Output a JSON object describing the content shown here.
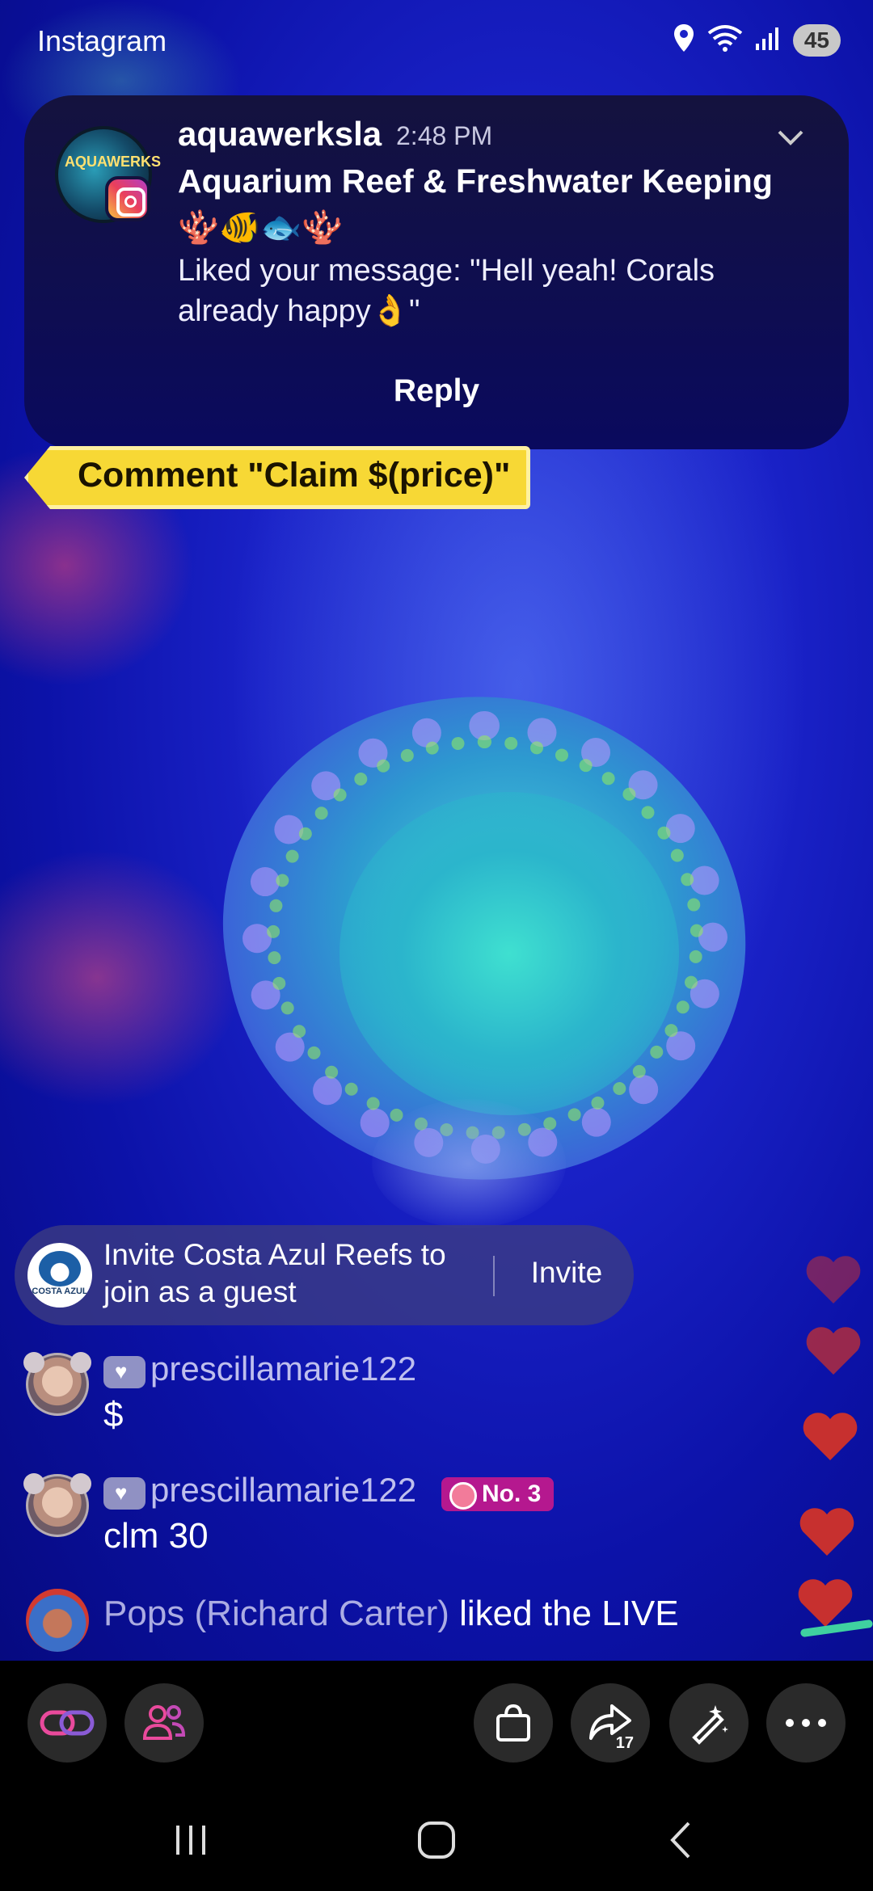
{
  "status": {
    "app_name": "Instagram",
    "battery": "45",
    "icons": [
      "location-icon",
      "wifi-icon",
      "signal-icon",
      "battery-icon"
    ]
  },
  "notification": {
    "username": "aquawerksla",
    "time": "2:48 PM",
    "title": "Aquarium Reef & Freshwater Keeping 🪸🐠🐟🪸",
    "body": "Liked your message: \"Hell yeah! Corals already happy👌\"",
    "reply_label": "Reply",
    "avatar_text": "AQUAWERKS"
  },
  "claim_tag": {
    "text": "Comment \"Claim $(price)\""
  },
  "invite": {
    "text": "Invite Costa Azul Reefs to join as a guest",
    "button_label": "Invite",
    "avatar_text": "COSTA AZUL"
  },
  "comments": [
    {
      "username": "prescillamarie122",
      "message": "$"
    },
    {
      "username": "prescillamarie122",
      "message": "clm 30",
      "rank": "No. 3"
    }
  ],
  "activity": {
    "name": "Pops (Richard Carter)",
    "action": " liked the LIVE"
  },
  "toolbar": {
    "share_count": "17",
    "buttons": [
      "link-icon",
      "people-icon",
      "shopping-bag-icon",
      "share-icon",
      "magic-wand-icon",
      "more-icon"
    ]
  },
  "colors": {
    "accent_pink": "#e94a9c",
    "heart_red": "#c7302f",
    "tag_yellow": "#f7d835",
    "rank_magenta": "#b5188f"
  }
}
